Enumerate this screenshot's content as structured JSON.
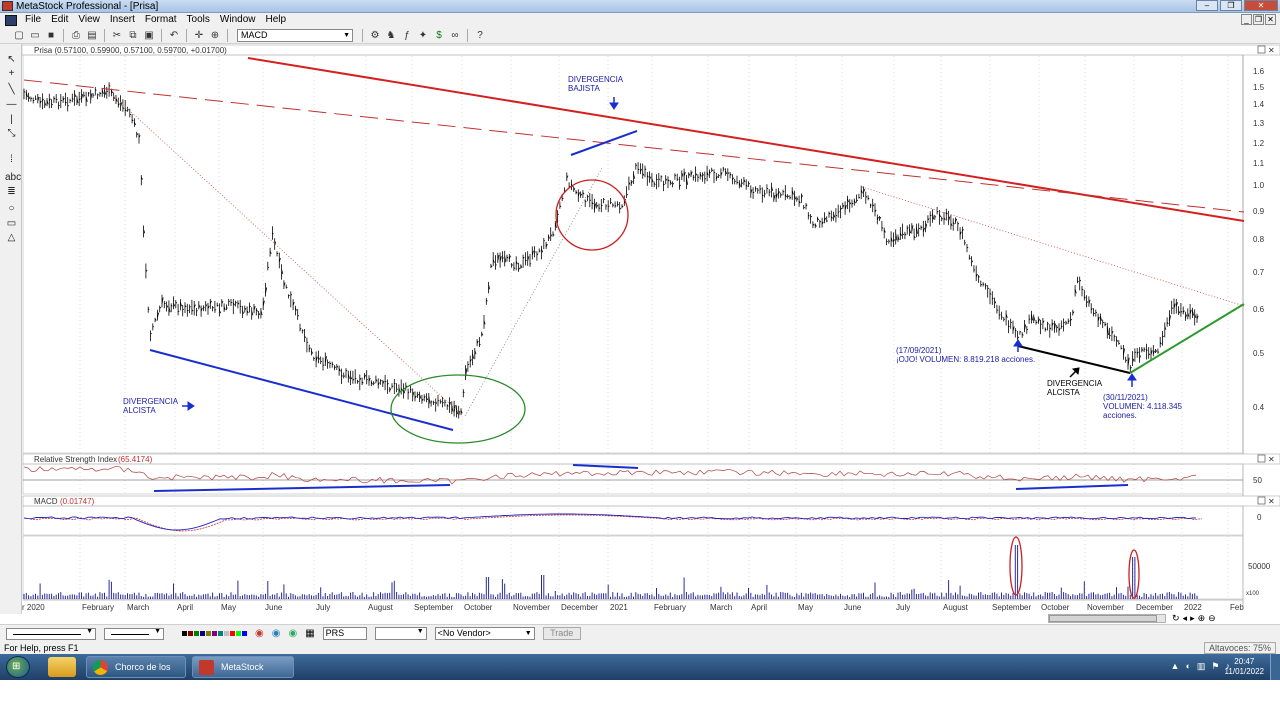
{
  "window": {
    "title": "MetaStock Professional - [Prisa]",
    "menu": [
      "File",
      "Edit",
      "View",
      "Insert",
      "Format",
      "Tools",
      "Window",
      "Help"
    ]
  },
  "toolbar": {
    "indicator_select": "MACD"
  },
  "panes": {
    "price": {
      "header": "Prisa (0.57100, 0.59900, 0.57100, 0.59700, +0.01700)",
      "y_ticks": [
        "1.6",
        "1.5",
        "1.4",
        "1.3",
        "1.2",
        "1.1",
        "1.0",
        "0.9",
        "0.8",
        "0.7",
        "0.6",
        "0.5",
        "0.4"
      ],
      "annotations": {
        "div_bajista_1": "DIVERGENCIA",
        "div_bajista_2": "BAJISTA",
        "div_alcista_1": "DIVERGENCIA",
        "div_alcista_2": "ALCISTA",
        "sep_date": "(17/09/2021)",
        "sep_vol": "¡OJO! VOLUMEN: 8.819.218 acciones.",
        "div_alcista_b1": "DIVERGENCIA",
        "div_alcista_b2": "ALCISTA",
        "nov_date": "(30/11/2021)",
        "nov_vol": "VOLUMEN: 4.118.345",
        "nov_unit": "acciones."
      }
    },
    "rsi": {
      "header": "Relative Strength Index",
      "value": "(65.4174)",
      "y_tick": "50"
    },
    "macd": {
      "header": "MACD",
      "value": "(0.01747)",
      "y_tick": "0"
    },
    "volume": {
      "y_tick": "50000",
      "scale_tag": "x100"
    }
  },
  "x_axis": [
    "r 2020",
    "February",
    "March",
    "April",
    "May",
    "June",
    "July",
    "August",
    "September",
    "October",
    "November",
    "December",
    "2021",
    "February",
    "March",
    "April",
    "May",
    "June",
    "July",
    "August",
    "September",
    "October",
    "November",
    "December",
    "2022",
    "Feb"
  ],
  "bottom_toolbar": {
    "symbol": "PRS",
    "vendor": "<No Vendor>",
    "trade": "Trade"
  },
  "status": {
    "help": "For Help, press F1",
    "right": "Altavoces: 75%"
  },
  "taskbar": {
    "tasks": [
      "Chorco de los lob...",
      "MetaStock Profes..."
    ],
    "time": "20:47",
    "date": "11/01/2022"
  },
  "colors": {
    "trend_red": "#d42020",
    "trend_blue": "#1a2ed0",
    "trend_green": "#2a9a2a",
    "circle_green": "#2a8a2a",
    "circle_red": "#cc1f1f",
    "arrow_blue": "#1a2ed0",
    "text_blue": "#1a1aa8",
    "rsi_line": "#b04040",
    "macd_line": "#2020c0"
  },
  "icons": [
    "new-icon",
    "open-icon",
    "save-icon",
    "print-icon",
    "cut-icon",
    "copy-icon",
    "paste-icon",
    "undo-icon",
    "crosshair-icon",
    "zoom-icon",
    "explorer-icon",
    "expert-icon",
    "forecast-icon",
    "help-icon"
  ]
}
